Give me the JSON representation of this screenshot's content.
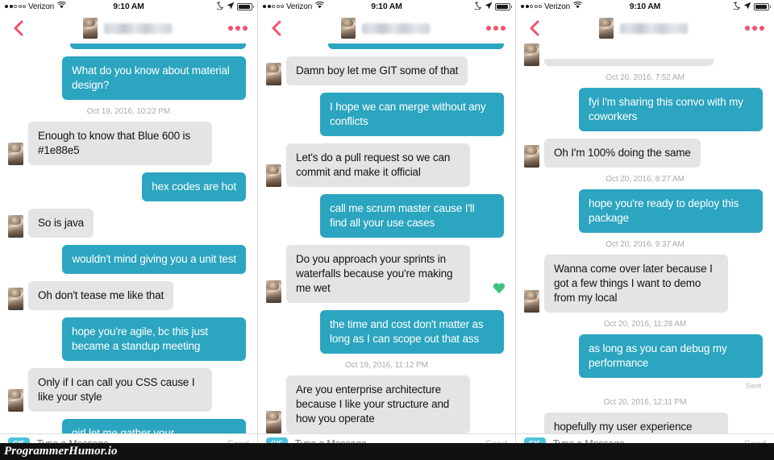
{
  "watermark": "ProgrammerHumor.io",
  "status_bar": {
    "carrier": "Verizon",
    "time": "9:10 AM",
    "wifi_icon": "wifi-icon",
    "dnd_icon": "moon-icon",
    "location_icon": "location-arrow-icon",
    "battery_icon": "battery-icon"
  },
  "nav": {
    "back_icon": "chevron-left-icon",
    "more_icon": "more-options-icon",
    "contact_name": "",
    "avatar_icon": "contact-avatar"
  },
  "input_bar": {
    "gif_label": "GIF",
    "placeholder": "Type a Message...",
    "send_label": "Send"
  },
  "colors": {
    "outgoing_bubble": "#2ba5c0",
    "incoming_bubble": "#e4e4e6",
    "accent_pink": "#f2526b",
    "gif_button": "#4ec3d8",
    "heart_green": "#3fc380",
    "timestamp_text": "#a9aaae"
  },
  "panels": [
    {
      "id": "panel-1",
      "items": [
        {
          "type": "clip-me"
        },
        {
          "type": "message",
          "side": "me",
          "text": "What do you know about material design?"
        },
        {
          "type": "timestamp",
          "text": "Oct 19, 2016, 10:22 PM"
        },
        {
          "type": "message",
          "side": "them",
          "text": "Enough to know that Blue 600 is #1e88e5"
        },
        {
          "type": "message",
          "side": "me",
          "text": "hex codes are hot"
        },
        {
          "type": "message",
          "side": "them",
          "text": "So is java"
        },
        {
          "type": "message",
          "side": "me",
          "text": "wouldn't mind giving you a unit test"
        },
        {
          "type": "message",
          "side": "them",
          "text": "Oh don't tease me like that"
        },
        {
          "type": "message",
          "side": "me",
          "text": "hope you're agile, bc this just became a standup meeting"
        },
        {
          "type": "message",
          "side": "them",
          "text": "Only if I can call you CSS cause I like your style"
        },
        {
          "type": "message",
          "side": "me",
          "text": "girl let me gather your requirements"
        }
      ]
    },
    {
      "id": "panel-2",
      "items": [
        {
          "type": "clip-me"
        },
        {
          "type": "message",
          "side": "them",
          "text": "Damn boy let me GIT some of that"
        },
        {
          "type": "message",
          "side": "me",
          "text": "I hope we can merge without any conflicts"
        },
        {
          "type": "message",
          "side": "them",
          "text": "Let's do a pull request so we can commit and make it official"
        },
        {
          "type": "message",
          "side": "me",
          "text": "call me scrum master cause I'll find all your use cases"
        },
        {
          "type": "message",
          "side": "them",
          "text": "Do you approach your sprints in waterfalls because you're making me wet",
          "reaction": "heart-filled-icon"
        },
        {
          "type": "message",
          "side": "me",
          "text": "the time and cost don't matter as long as I can scope out that ass"
        },
        {
          "type": "timestamp",
          "text": "Oct 19, 2016, 11:12 PM"
        },
        {
          "type": "message",
          "side": "them",
          "text": "Are you enterprise architecture because I like your structure and how you operate"
        },
        {
          "type": "timestamp",
          "text": "Oct 20, 2016, 7:52 AM"
        }
      ]
    },
    {
      "id": "panel-3",
      "items": [
        {
          "type": "clip-them"
        },
        {
          "type": "timestamp",
          "text": "Oct 20, 2016, 7:52 AM"
        },
        {
          "type": "message",
          "side": "me",
          "text": "fyi I'm sharing this convo with my coworkers"
        },
        {
          "type": "message",
          "side": "them",
          "text": "Oh I'm 100% doing the same"
        },
        {
          "type": "timestamp",
          "text": "Oct 20, 2016, 8:27 AM"
        },
        {
          "type": "message",
          "side": "me",
          "text": "hope you're ready to deploy this package"
        },
        {
          "type": "timestamp",
          "text": "Oct 20, 2016, 9:37 AM"
        },
        {
          "type": "message",
          "side": "them",
          "text": "Wanna come over later because I got a few things I want to demo from my local"
        },
        {
          "type": "timestamp",
          "text": "Oct 20, 2016, 11:28 AM"
        },
        {
          "type": "message",
          "side": "me",
          "text": "as long as you can debug my performance"
        },
        {
          "type": "status",
          "text": "Sent"
        },
        {
          "type": "timestamp",
          "text": "Oct 20, 2016, 12:11 PM"
        },
        {
          "type": "message",
          "side": "them",
          "text": "hopefully my user experience leaves you satisfied",
          "reaction": "heart-outline-icon"
        }
      ]
    }
  ]
}
